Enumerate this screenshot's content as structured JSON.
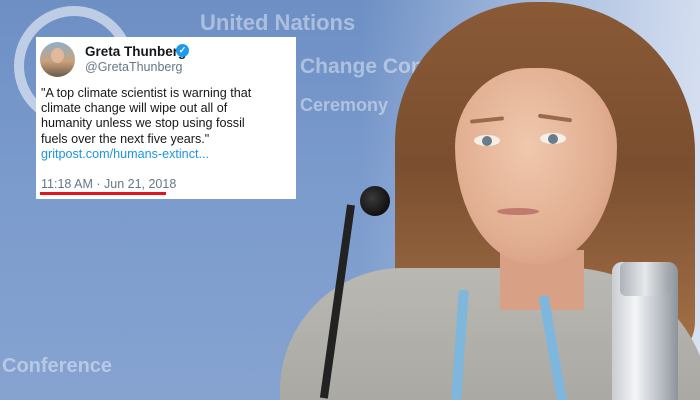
{
  "background": {
    "org_text": "United Nations",
    "line_2": "Change Confe",
    "line_3": "Ceremony",
    "bottom_text": "Conference"
  },
  "tweet": {
    "display_name": "Greta Thunberg",
    "handle": "@GretaThunberg",
    "verified_icon": "verified-badge-icon",
    "text_lines": [
      "\"A top climate scientist is warning that",
      "climate change will wipe out all of",
      "humanity unless we stop using fossil",
      "fuels over the next five years.\""
    ],
    "link_text": "gritpost.com/humans-extinct...",
    "timestamp": "11:18 AM · Jun 21, 2018",
    "colors": {
      "link": "#1b95e0",
      "verified": "#1d9bf0",
      "highlight_underline": "#e3141b"
    }
  }
}
